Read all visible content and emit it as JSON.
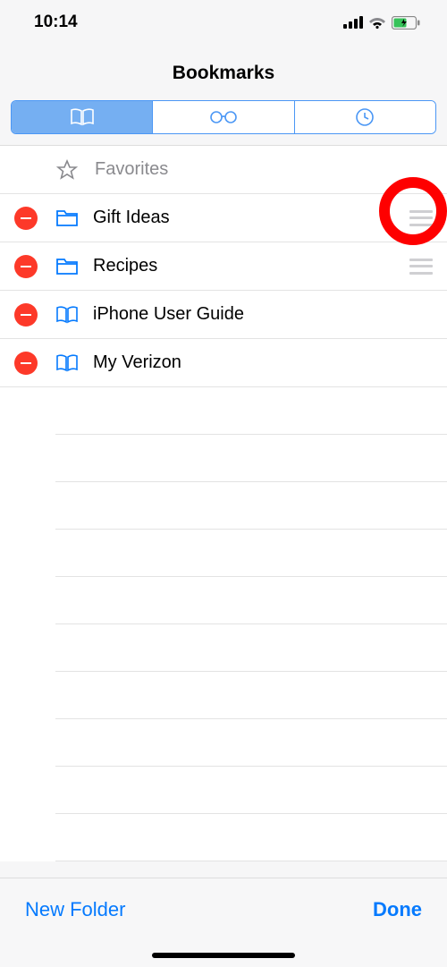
{
  "status": {
    "time": "10:14"
  },
  "header": {
    "title": "Bookmarks"
  },
  "tabs": {
    "active": 0
  },
  "rows": [
    {
      "type": "favorites",
      "label": "Favorites"
    },
    {
      "type": "folder",
      "label": "Gift Ideas",
      "delete": true,
      "drag": true
    },
    {
      "type": "folder",
      "label": "Recipes",
      "delete": true,
      "drag": true
    },
    {
      "type": "bookmark",
      "label": "iPhone User Guide",
      "delete": true
    },
    {
      "type": "bookmark",
      "label": "My Verizon",
      "delete": true
    }
  ],
  "toolbar": {
    "newFolder": "New Folder",
    "done": "Done"
  }
}
